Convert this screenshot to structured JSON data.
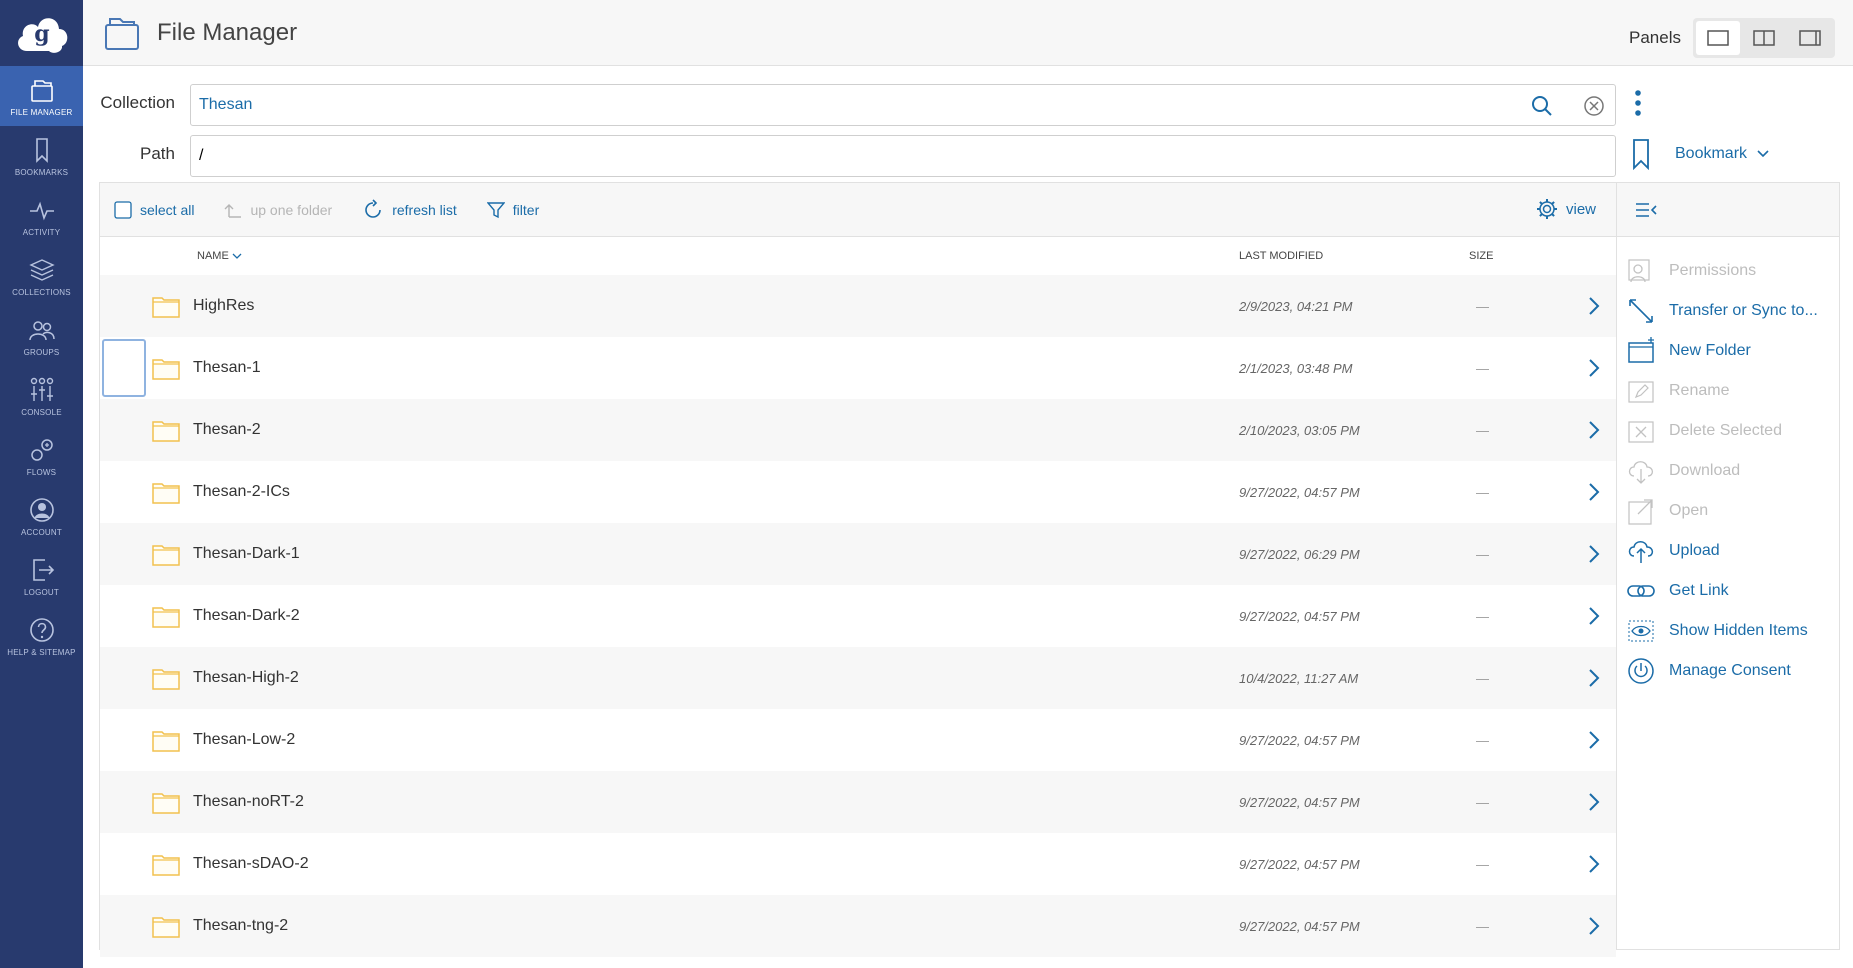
{
  "sidebar": {
    "items": [
      {
        "label": "FILE MANAGER",
        "icon": "file-manager-icon"
      },
      {
        "label": "BOOKMARKS",
        "icon": "bookmark-icon"
      },
      {
        "label": "ACTIVITY",
        "icon": "activity-icon"
      },
      {
        "label": "COLLECTIONS",
        "icon": "collections-icon"
      },
      {
        "label": "GROUPS",
        "icon": "groups-icon"
      },
      {
        "label": "CONSOLE",
        "icon": "console-icon"
      },
      {
        "label": "FLOWS",
        "icon": "flows-icon"
      },
      {
        "label": "ACCOUNT",
        "icon": "account-icon"
      },
      {
        "label": "LOGOUT",
        "icon": "logout-icon"
      },
      {
        "label": "HELP & SITEMAP",
        "icon": "help-icon"
      }
    ]
  },
  "header": {
    "title": "File Manager",
    "panels_label": "Panels"
  },
  "collection": {
    "label": "Collection",
    "value": "Thesan"
  },
  "path": {
    "label": "Path",
    "value": "/"
  },
  "bookmark": {
    "label": "Bookmark"
  },
  "toolbar": {
    "select_all": "select all",
    "up_one_folder": "up one folder",
    "refresh_list": "refresh list",
    "filter": "filter",
    "view": "view"
  },
  "columns": {
    "name": "NAME",
    "last_modified": "LAST MODIFIED",
    "size": "SIZE"
  },
  "files": [
    {
      "name": "HighRes",
      "modified": "2/9/2023, 04:21 PM",
      "size": "—"
    },
    {
      "name": "Thesan-1",
      "modified": "2/1/2023, 03:48 PM",
      "size": "—"
    },
    {
      "name": "Thesan-2",
      "modified": "2/10/2023, 03:05 PM",
      "size": "—"
    },
    {
      "name": "Thesan-2-ICs",
      "modified": "9/27/2022, 04:57 PM",
      "size": "—"
    },
    {
      "name": "Thesan-Dark-1",
      "modified": "9/27/2022, 06:29 PM",
      "size": "—"
    },
    {
      "name": "Thesan-Dark-2",
      "modified": "9/27/2022, 04:57 PM",
      "size": "—"
    },
    {
      "name": "Thesan-High-2",
      "modified": "10/4/2022, 11:27 AM",
      "size": "—"
    },
    {
      "name": "Thesan-Low-2",
      "modified": "9/27/2022, 04:57 PM",
      "size": "—"
    },
    {
      "name": "Thesan-noRT-2",
      "modified": "9/27/2022, 04:57 PM",
      "size": "—"
    },
    {
      "name": "Thesan-sDAO-2",
      "modified": "9/27/2022, 04:57 PM",
      "size": "—"
    },
    {
      "name": "Thesan-tng-2",
      "modified": "9/27/2022, 04:57 PM",
      "size": "—"
    }
  ],
  "actions": [
    {
      "label": "Permissions",
      "icon": "permissions-icon",
      "enabled": false
    },
    {
      "label": "Transfer or Sync to...",
      "icon": "transfer-icon",
      "enabled": true
    },
    {
      "label": "New Folder",
      "icon": "new-folder-icon",
      "enabled": true
    },
    {
      "label": "Rename",
      "icon": "rename-icon",
      "enabled": false
    },
    {
      "label": "Delete Selected",
      "icon": "delete-icon",
      "enabled": false
    },
    {
      "label": "Download",
      "icon": "download-icon",
      "enabled": false
    },
    {
      "label": "Open",
      "icon": "open-icon",
      "enabled": false
    },
    {
      "label": "Upload",
      "icon": "upload-icon",
      "enabled": true
    },
    {
      "label": "Get Link",
      "icon": "link-icon",
      "enabled": true
    },
    {
      "label": "Show Hidden Items",
      "icon": "eye-icon",
      "enabled": true
    },
    {
      "label": "Manage Consent",
      "icon": "power-icon",
      "enabled": true
    }
  ],
  "colors": {
    "sidebar": "#283a6e",
    "accent": "#1b6ca8",
    "folder": "#f2c14e"
  }
}
